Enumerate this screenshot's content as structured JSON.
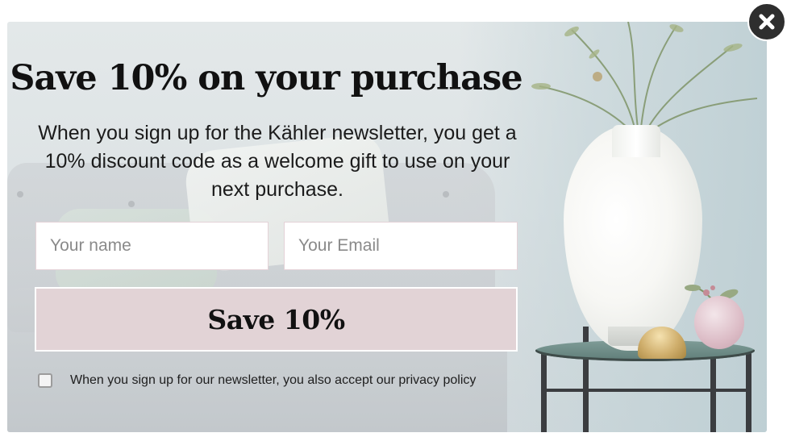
{
  "popup": {
    "headline": "Save 10% on your purchase",
    "intro": "When you sign up for the Kähler newsletter, you get a 10% discount code as a welcome gift to use on your next purchase.",
    "form": {
      "name_placeholder": "Your name",
      "email_placeholder": "Your Email",
      "submit_label": "Save 10%",
      "consent_label": "When you sign up for our newsletter, you also accept our privacy policy",
      "consent_checked": false
    },
    "close_icon": "close-icon",
    "colors": {
      "button_bg": "#e2d3d6",
      "field_border": "#e4d2d7",
      "close_bg": "#2e2e2e"
    }
  }
}
